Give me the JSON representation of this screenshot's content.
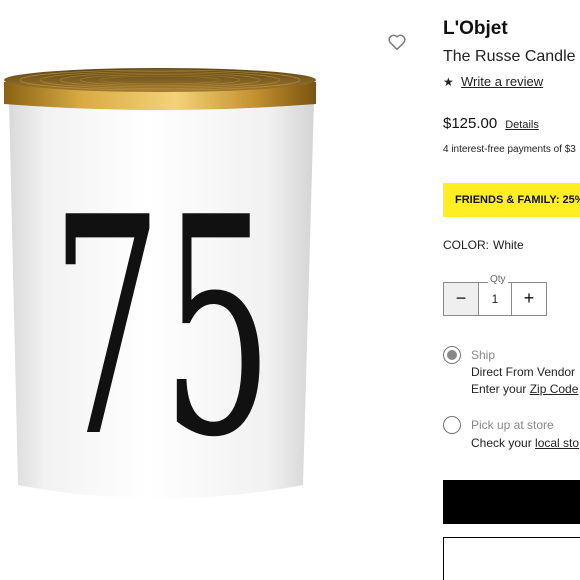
{
  "product": {
    "brand": "L'Objet",
    "name": "The Russe Candle",
    "image_number": "75",
    "review_icon": "star-icon",
    "review_link": "Write a review",
    "favorite_icon": "heart-icon"
  },
  "pricing": {
    "price": "$125.00",
    "details_link": "Details",
    "installments": "4 interest-free payments of $3"
  },
  "promo": {
    "text": "FRIENDS & FAMILY: 25%",
    "background": "#ffee22"
  },
  "color": {
    "label": "COLOR:",
    "value": "White"
  },
  "quantity": {
    "label": "Qty",
    "value": "1",
    "minus": "−",
    "plus": "+"
  },
  "fulfillment": {
    "ship": {
      "title": "Ship",
      "line1": "Direct From Vendor",
      "line2_prefix": "Enter your ",
      "line2_link": "Zip Code",
      "selected": true
    },
    "pickup": {
      "title": "Pick up at store",
      "line1_prefix": "Check your ",
      "line1_link": "local sto",
      "selected": false
    }
  }
}
